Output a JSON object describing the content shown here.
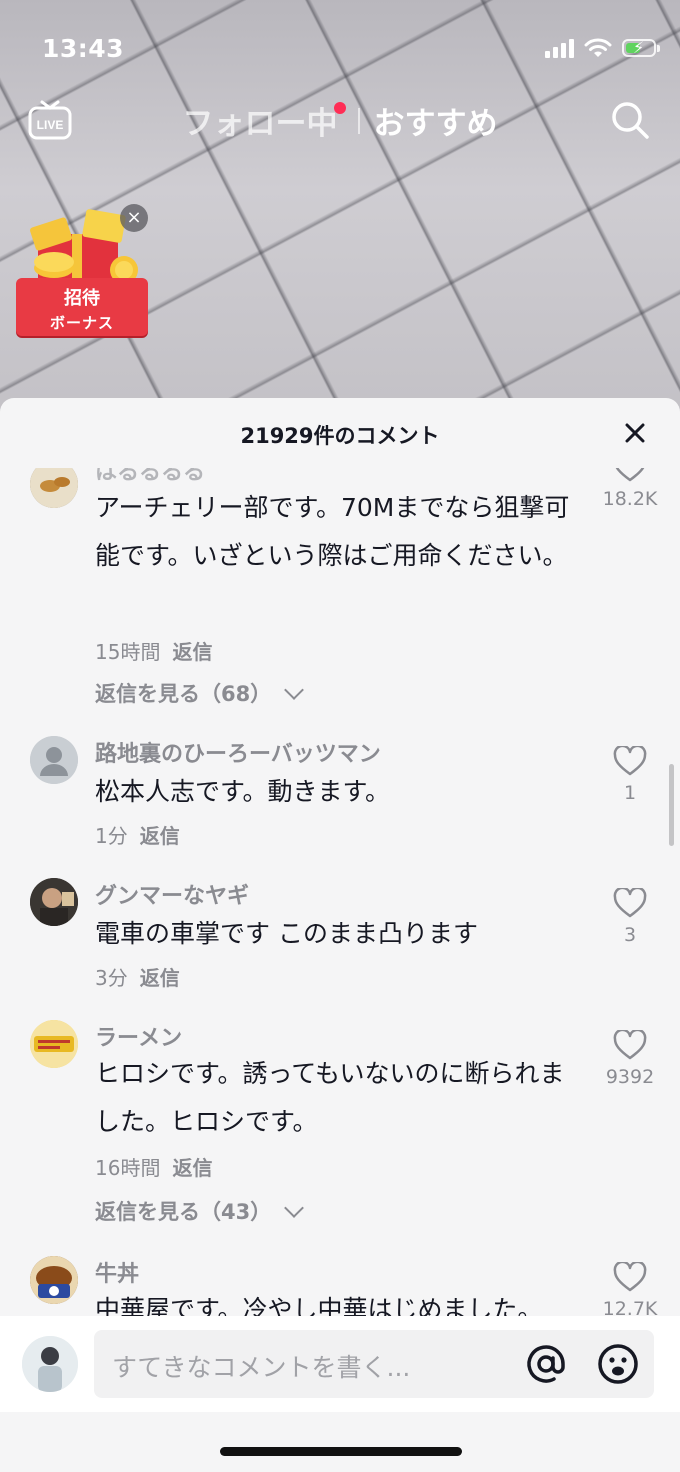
{
  "status_bar": {
    "time": "13:43",
    "battery_charging": true
  },
  "top_nav": {
    "live_label": "LIVE",
    "tabs": [
      {
        "label": "フォロー中",
        "active": false,
        "has_dot": true
      },
      {
        "label": "おすすめ",
        "active": true
      }
    ]
  },
  "bonus": {
    "line1": "招待",
    "line2": "ボーナス"
  },
  "sheet": {
    "title": "21929件のコメント"
  },
  "comments": [
    {
      "user": "はるるるる",
      "text": "アーチェリー部です。70Mまでなら狙撃可能です。いざという際はご用命ください。",
      "time": "15時間",
      "reply_label": "返信",
      "view_replies": "返信を見る（68）",
      "likes": "18.2K"
    },
    {
      "user": "路地裏のひーろーバッツマン",
      "text": "松本人志です。動きます。",
      "time": "1分",
      "reply_label": "返信",
      "likes": "1"
    },
    {
      "user": "グンマーなヤギ",
      "text": "電車の車掌です このまま凸ります",
      "time": "3分",
      "reply_label": "返信",
      "likes": "3"
    },
    {
      "user": "ラーメン",
      "text": "ヒロシです。誘ってもいないのに断られました。ヒロシです。",
      "time": "16時間",
      "reply_label": "返信",
      "view_replies": "返信を見る（43）",
      "likes": "9392"
    },
    {
      "user": "牛丼",
      "text": "中華屋です。冷やし中華はじめました。",
      "likes": "12.7K"
    }
  ],
  "input": {
    "placeholder": "すてきなコメントを書く..."
  },
  "colors": {
    "accent_dot": "#ff2d55",
    "bonus_red": "#e83a44"
  }
}
